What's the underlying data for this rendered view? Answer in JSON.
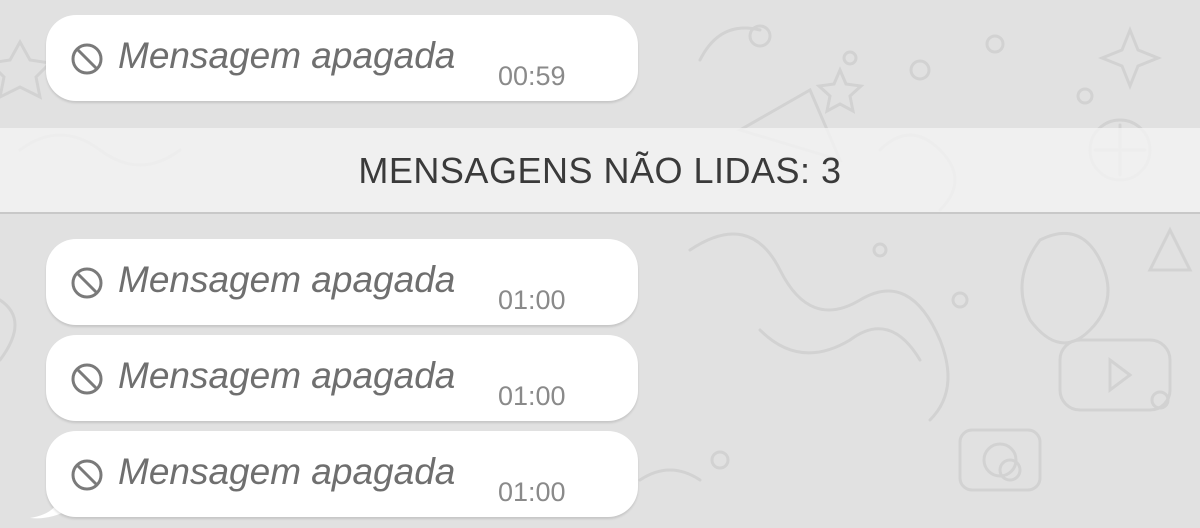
{
  "chat": {
    "messages_before": [
      {
        "text": "Mensagem apagada",
        "time": "00:59",
        "icon": "prohibited-icon"
      }
    ],
    "unread_divider": {
      "label": "MENSAGENS NÃO LIDAS: 3"
    },
    "messages_after": [
      {
        "text": "Mensagem apagada",
        "time": "01:00",
        "icon": "prohibited-icon"
      },
      {
        "text": "Mensagem apagada",
        "time": "01:00",
        "icon": "prohibited-icon"
      },
      {
        "text": "Mensagem apagada",
        "time": "01:00",
        "icon": "prohibited-icon"
      }
    ]
  },
  "colors": {
    "wallpaper": "#e1e1e1",
    "bubble": "#ffffff",
    "deleted_text": "#6f6f6f",
    "timestamp": "#8a8a8a",
    "divider_text": "#3a3a3a"
  }
}
